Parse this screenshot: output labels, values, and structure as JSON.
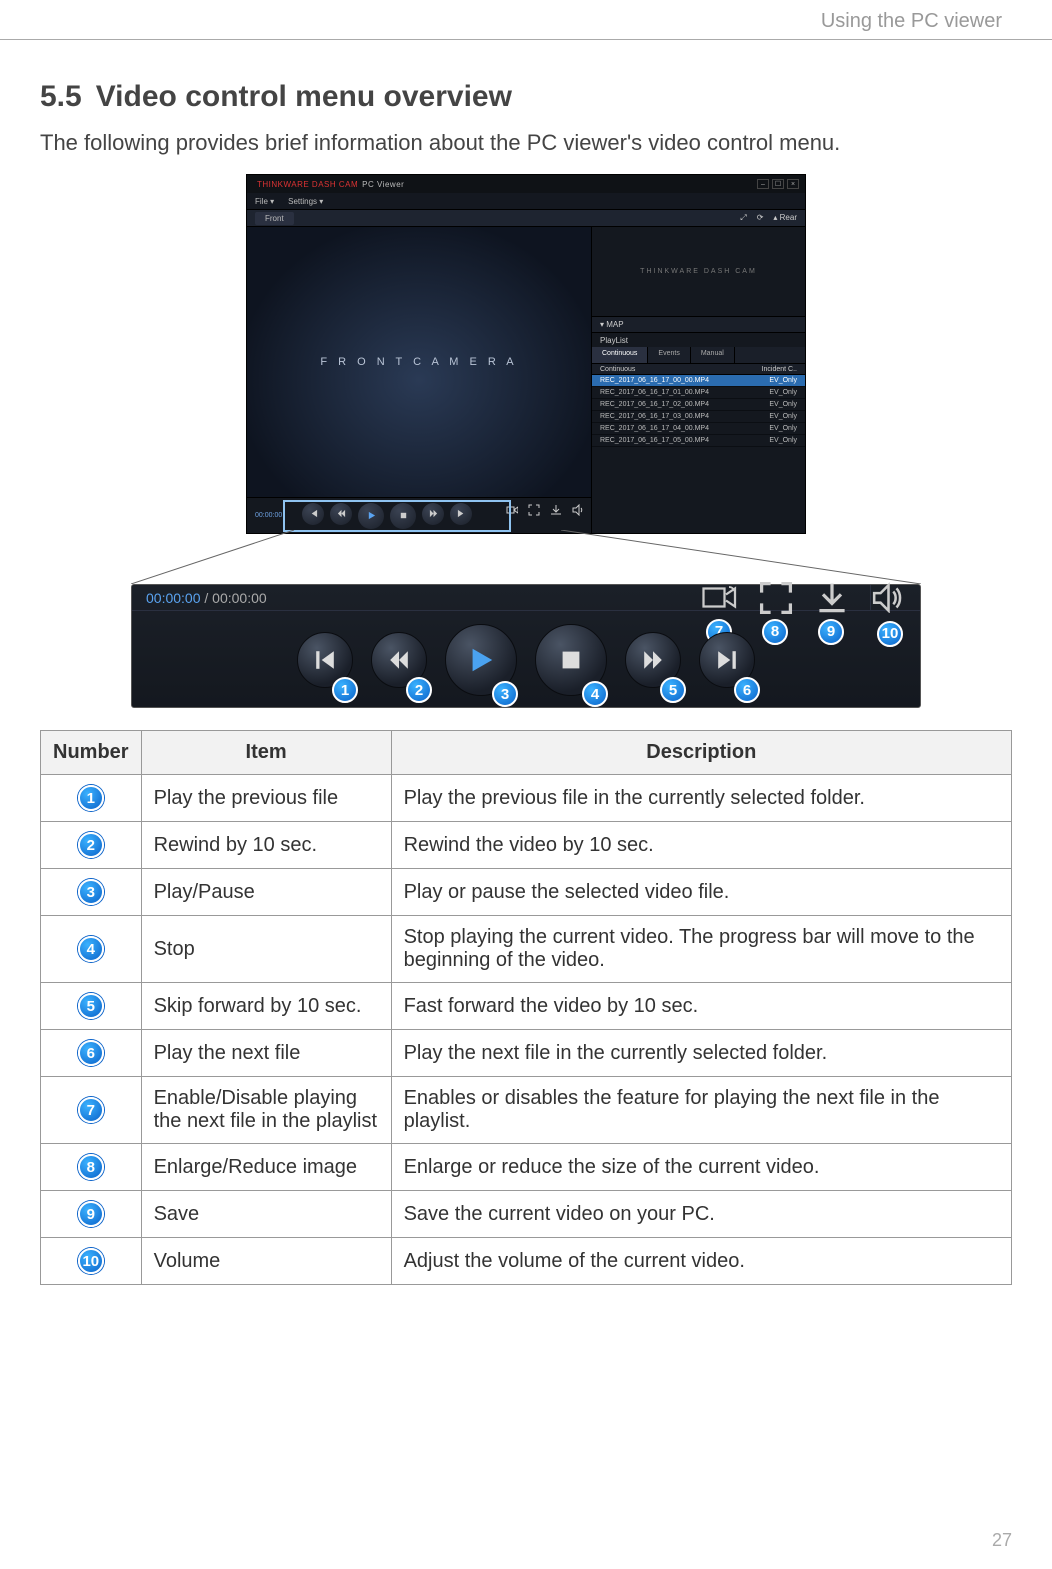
{
  "page_header": "Using the PC viewer",
  "page_number": "27",
  "section_number": "5.5",
  "section_title": "Video control menu overview",
  "intro": "The following provides brief information about the PC viewer's video control menu.",
  "pcviewer": {
    "brand": "THINKWARE  DASH CAM",
    "brand_suffix": "PC Viewer",
    "menu": [
      "File  ▾",
      "Settings  ▾"
    ],
    "front_tab": "Front",
    "rear_btn": "Rear",
    "front_label": "F R O N T   C A M E R A",
    "mini_label": "THINKWARE DASH CAM",
    "map_toggle": "▾  MAP",
    "playlist_head": "PlayList",
    "playlist_tabs": [
      "Continuous",
      "Events",
      "Manual"
    ],
    "playlist_tab_active": 0,
    "col_a": "Continuous",
    "col_b": "Incident C..",
    "rows": [
      {
        "a": "REC_2017_06_16_17_00_00.MP4",
        "b": "EV_Only"
      },
      {
        "a": "REC_2017_06_16_17_01_00.MP4",
        "b": "EV_Only"
      },
      {
        "a": "REC_2017_06_16_17_02_00.MP4",
        "b": "EV_Only"
      },
      {
        "a": "REC_2017_06_16_17_03_00.MP4",
        "b": "EV_Only"
      },
      {
        "a": "REC_2017_06_16_17_04_00.MP4",
        "b": "EV_Only"
      },
      {
        "a": "REC_2017_06_16_17_05_00.MP4",
        "b": "EV_Only"
      }
    ],
    "mini_time": "00:00:00"
  },
  "zoombar": {
    "time_current": "00:00:00",
    "time_sep": " / ",
    "time_total": "00:00:00"
  },
  "table": {
    "head": [
      "Number",
      "Item",
      "Description"
    ],
    "rows": [
      {
        "n": "1",
        "item": "Play the previous file",
        "desc": "Play the previous file in the currently selected folder."
      },
      {
        "n": "2",
        "item": "Rewind by 10 sec.",
        "desc": "Rewind the video by 10 sec."
      },
      {
        "n": "3",
        "item": "Play/Pause",
        "desc": "Play or pause the selected video file."
      },
      {
        "n": "4",
        "item": "Stop",
        "desc": "Stop playing the current video. The progress bar will move to the beginning of the video."
      },
      {
        "n": "5",
        "item": "Skip forward by 10 sec.",
        "desc": "Fast forward the video by 10 sec."
      },
      {
        "n": "6",
        "item": "Play the next file",
        "desc": "Play the next file in the currently selected folder."
      },
      {
        "n": "7",
        "item": "Enable/Disable playing the next file in the playlist",
        "desc": "Enables or disables the feature for playing the next file in the playlist."
      },
      {
        "n": "8",
        "item": "Enlarge/Reduce image",
        "desc": "Enlarge or reduce the size of the current video."
      },
      {
        "n": "9",
        "item": "Save",
        "desc": "Save the current video on your PC."
      },
      {
        "n": "10",
        "item": "Volume",
        "desc": "Adjust the volume of the current video."
      }
    ]
  }
}
